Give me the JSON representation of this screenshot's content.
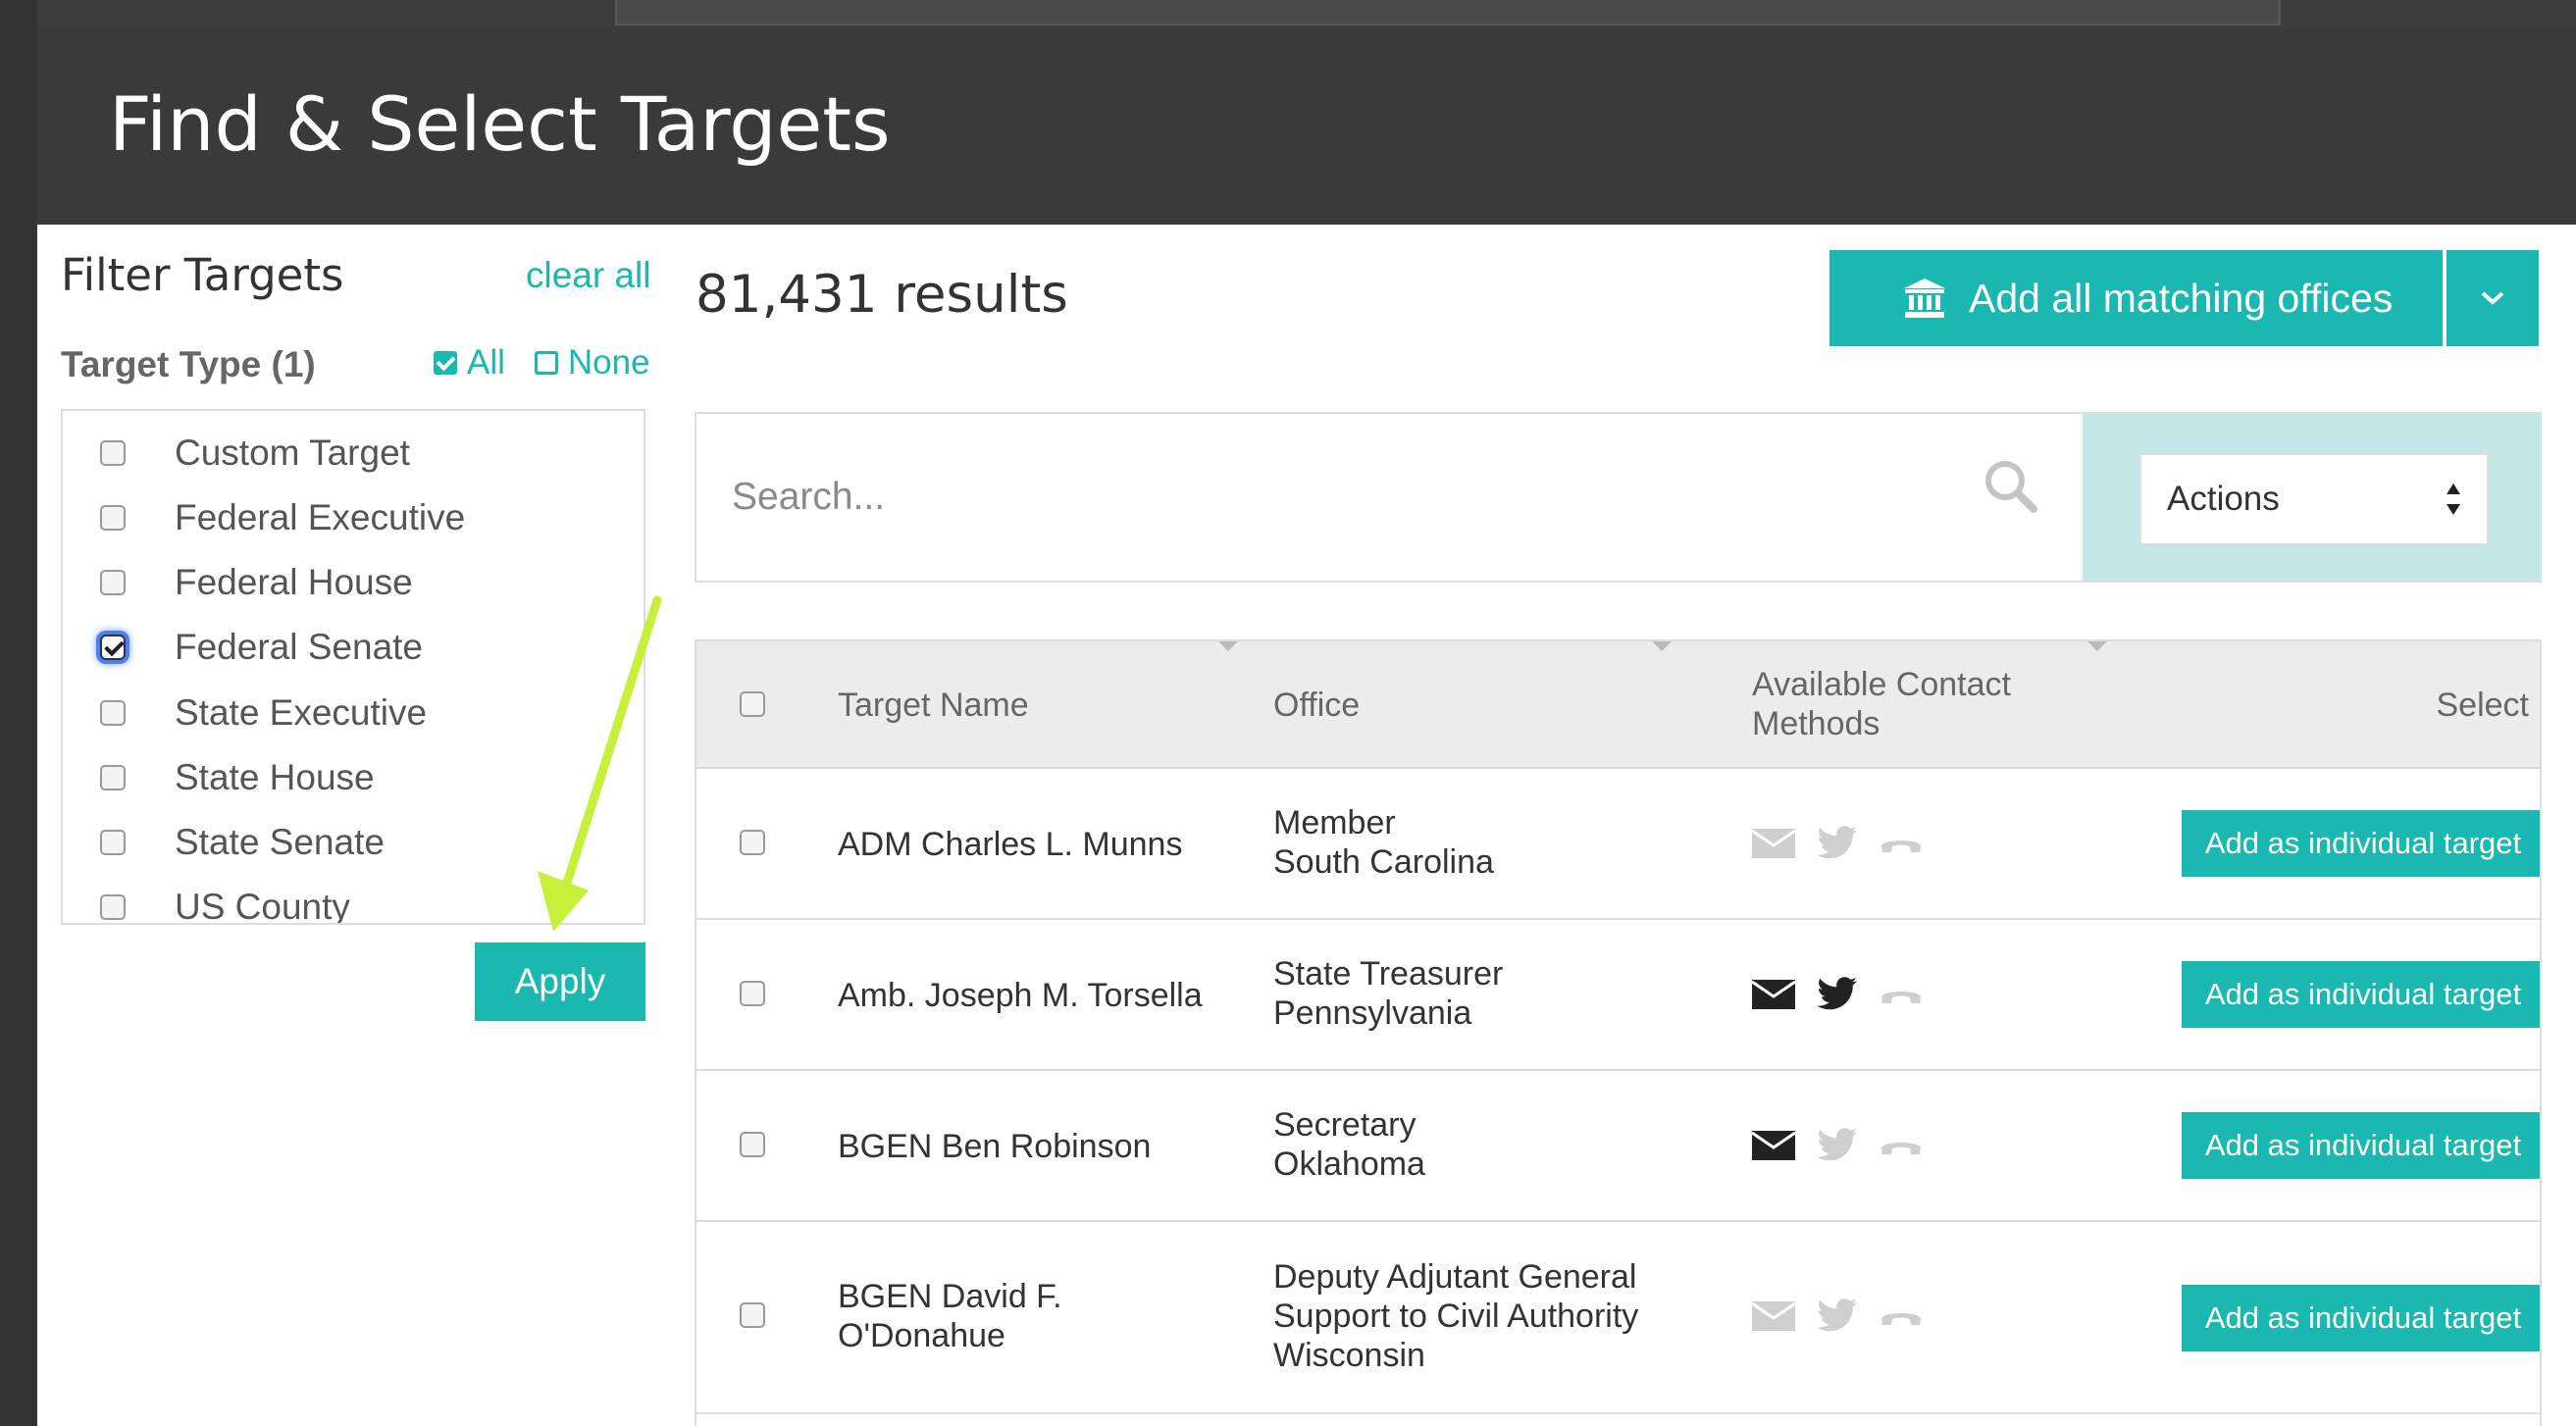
{
  "modal": {
    "title": "Find & Select Targets"
  },
  "sidebar": {
    "title": "Filter Targets",
    "clear_all": "clear all",
    "target_type_label": "Target Type (1)",
    "all_label": "All",
    "none_label": "None",
    "types": [
      {
        "label": "Custom Target",
        "checked": false
      },
      {
        "label": "Federal Executive",
        "checked": false
      },
      {
        "label": "Federal House",
        "checked": false
      },
      {
        "label": "Federal Senate",
        "checked": true
      },
      {
        "label": "State Executive",
        "checked": false
      },
      {
        "label": "State House",
        "checked": false
      },
      {
        "label": "State Senate",
        "checked": false
      },
      {
        "label": "US County",
        "checked": false
      }
    ],
    "apply_label": "Apply"
  },
  "main": {
    "results": "81,431 results",
    "add_all_label": "Add all matching offices",
    "search_placeholder": "Search...",
    "actions_label": "Actions"
  },
  "table": {
    "headers": {
      "name": "Target Name",
      "office": "Office",
      "methods_line1": "Available Contact",
      "methods_line2": "Methods",
      "select": "Select"
    },
    "add_label": "Add as individual target",
    "rows": [
      {
        "name": [
          "ADM Charles L. Munns"
        ],
        "office": [
          "Member",
          "South Carolina"
        ],
        "email": false,
        "twitter": false,
        "phone": false
      },
      {
        "name": [
          "Amb. Joseph M. Torsella"
        ],
        "office": [
          "State Treasurer",
          "Pennsylvania"
        ],
        "email": true,
        "twitter": true,
        "phone": false
      },
      {
        "name": [
          "BGEN Ben Robinson"
        ],
        "office": [
          "Secretary",
          "Oklahoma"
        ],
        "email": true,
        "twitter": false,
        "phone": false
      },
      {
        "name": [
          "BGEN David F.",
          "O'Donahue"
        ],
        "office": [
          "Deputy Adjutant General",
          "Support to Civil Authority",
          "Wisconsin"
        ],
        "email": false,
        "twitter": false,
        "phone": false
      }
    ]
  },
  "colors": {
    "accent": "#1ab8b0",
    "header_bg": "#3a3a3a",
    "icon_active": "#222222",
    "icon_inactive": "#c8c8c8",
    "annotation_arrow": "#c6f03a"
  },
  "icons": [
    "bank-icon",
    "chevron-down-icon",
    "search-icon",
    "sort-arrows-icon",
    "email-icon",
    "twitter-icon",
    "phone-icon"
  ]
}
